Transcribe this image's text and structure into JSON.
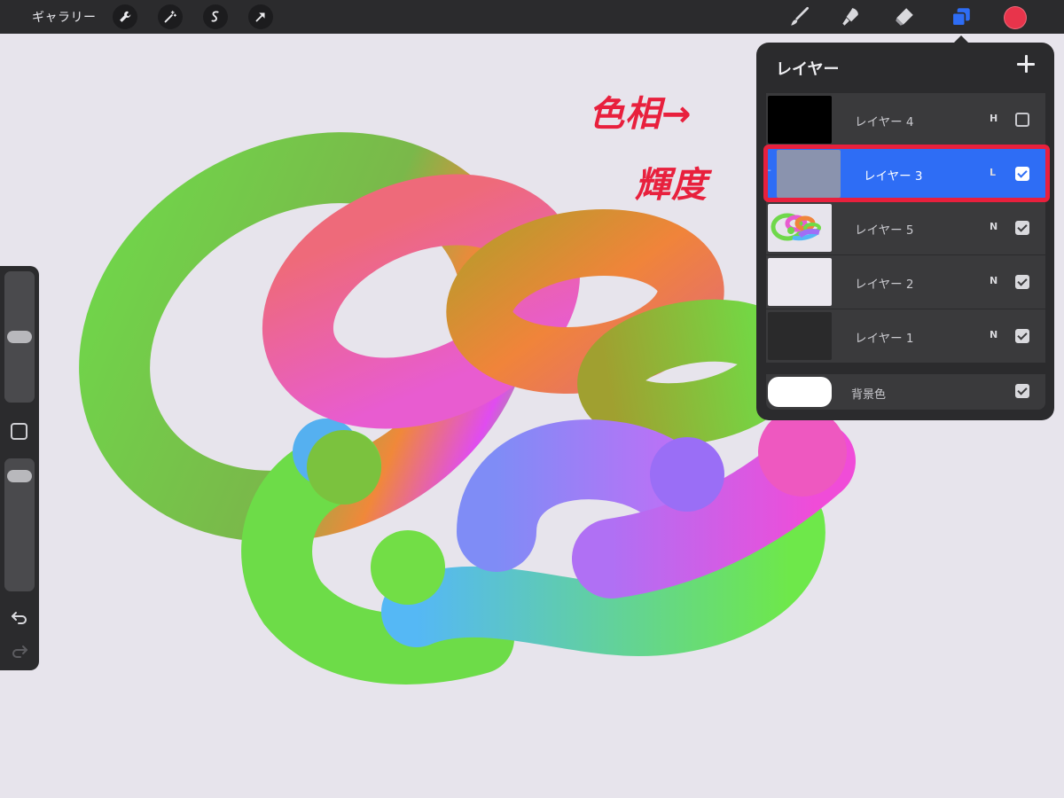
{
  "topbar": {
    "gallery_label": "ギャラリー",
    "left_tools": [
      "wrench-icon",
      "magic-wand-icon",
      "selection-icon",
      "transform-arrow-icon"
    ],
    "right_tools": [
      "brush-icon",
      "smudge-icon",
      "eraser-icon",
      "layers-icon"
    ],
    "current_color": "#e8344b"
  },
  "sidebar": {
    "brush_size_level": 0.5,
    "opacity_level": 0.08
  },
  "annotations": {
    "line1": "色相→",
    "line2": "輝度"
  },
  "layers_panel": {
    "title": "レイヤー",
    "layers": [
      {
        "name": "レイヤー 4",
        "mode": "H",
        "visible": false,
        "selected": false
      },
      {
        "name": "レイヤー 3",
        "mode": "L",
        "visible": true,
        "selected": true
      },
      {
        "name": "レイヤー 5",
        "mode": "N",
        "visible": true,
        "selected": false
      },
      {
        "name": "レイヤー 2",
        "mode": "N",
        "visible": true,
        "selected": false
      },
      {
        "name": "レイヤー 1",
        "mode": "N",
        "visible": true,
        "selected": false
      }
    ],
    "background": {
      "name": "背景色",
      "visible": true
    }
  },
  "colors": {
    "accent": "#2e6df5",
    "annotation_red": "#e8203d",
    "canvas_bg": "#e7e4ec"
  }
}
